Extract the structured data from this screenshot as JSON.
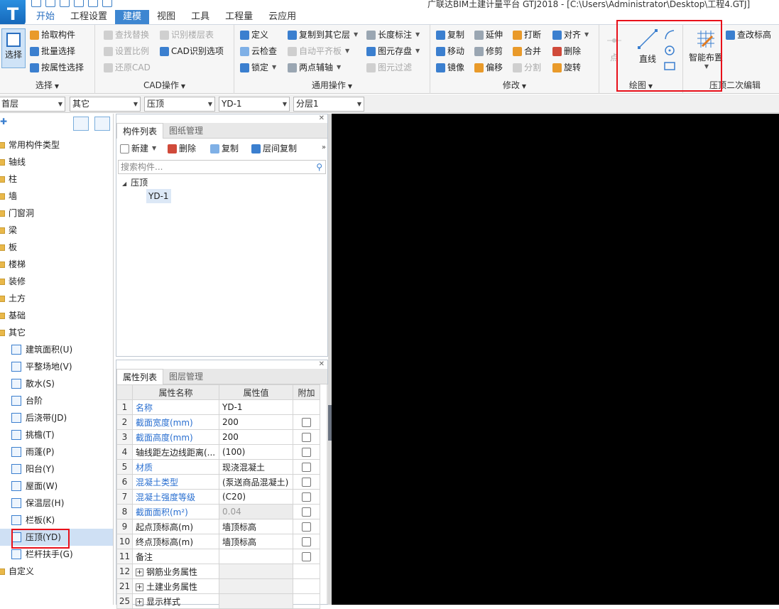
{
  "app": {
    "title": "广联达BIM土建计量平台 GTJ2018 - [C:\\Users\\Administrator\\Desktop\\工程4.GTJ]",
    "logo_letter": "T"
  },
  "menu_tabs": [
    {
      "label": "开始"
    },
    {
      "label": "工程设置"
    },
    {
      "label": "建模"
    },
    {
      "label": "视图"
    },
    {
      "label": "工具"
    },
    {
      "label": "工程量"
    },
    {
      "label": "云应用"
    }
  ],
  "ribbon": {
    "select": {
      "big": "选择",
      "pick": "拾取构件",
      "batch": "批量选择",
      "byprop": "按属性选择",
      "label": "选择"
    },
    "cad": {
      "find_replace": "查找替换",
      "identify_floor": "识别楼层表",
      "set_scale": "设置比例",
      "cad_options": "CAD识别选项",
      "restore_cad": "还原CAD",
      "label": "CAD操作"
    },
    "common": {
      "define": "定义",
      "copy_to_floor": "复制到其它层",
      "length_mark": "长度标注",
      "cloud_check": "云检查",
      "auto_flat": "自动平齐板",
      "save_element": "图元存盘",
      "lock": "锁定",
      "two_point_aux": "两点辅轴",
      "element_filter": "图元过滤",
      "label": "通用操作"
    },
    "modify": {
      "copy": "复制",
      "extend": "延伸",
      "break": "打断",
      "align": "对齐",
      "move": "移动",
      "trim": "修剪",
      "merge": "合并",
      "delete": "删除",
      "mirror": "镜像",
      "offset": "偏移",
      "split": "分割",
      "rotate": "旋转",
      "label": "修改"
    },
    "draw": {
      "point": "点",
      "line": "直线",
      "label": "绘图"
    },
    "secondary": {
      "smart_layout": "智能布置",
      "check_elevation": "查改标高",
      "label": "压顶二次编辑"
    }
  },
  "dropdowns": [
    "首层",
    "其它",
    "压顶",
    "YD-1",
    "分层1"
  ],
  "nav_tree": [
    {
      "label": "常用构件类型",
      "kind": "folder"
    },
    {
      "label": "轴线",
      "kind": "folder"
    },
    {
      "label": "柱",
      "kind": "folder"
    },
    {
      "label": "墙",
      "kind": "folder"
    },
    {
      "label": "门窗洞",
      "kind": "folder"
    },
    {
      "label": "梁",
      "kind": "folder"
    },
    {
      "label": "板",
      "kind": "folder"
    },
    {
      "label": "楼梯",
      "kind": "folder"
    },
    {
      "label": "装修",
      "kind": "folder"
    },
    {
      "label": "土方",
      "kind": "folder"
    },
    {
      "label": "基础",
      "kind": "folder"
    },
    {
      "label": "其它",
      "kind": "folder"
    },
    {
      "label": "建筑面积(U)",
      "kind": "leaf"
    },
    {
      "label": "平整场地(V)",
      "kind": "leaf"
    },
    {
      "label": "散水(S)",
      "kind": "leaf"
    },
    {
      "label": "台阶",
      "kind": "leaf"
    },
    {
      "label": "后浇带(JD)",
      "kind": "leaf"
    },
    {
      "label": "挑檐(T)",
      "kind": "leaf"
    },
    {
      "label": "雨蓬(P)",
      "kind": "leaf"
    },
    {
      "label": "阳台(Y)",
      "kind": "leaf"
    },
    {
      "label": "屋面(W)",
      "kind": "leaf"
    },
    {
      "label": "保温层(H)",
      "kind": "leaf"
    },
    {
      "label": "栏板(K)",
      "kind": "leaf"
    },
    {
      "label": "压顶(YD)",
      "kind": "leaf",
      "selected": true
    },
    {
      "label": "栏杆扶手(G)",
      "kind": "leaf"
    },
    {
      "label": "自定义",
      "kind": "folder"
    }
  ],
  "component_panel": {
    "tab_active": "构件列表",
    "tab_other": "图纸管理",
    "new": "新建",
    "delete": "删除",
    "copy": "复制",
    "floor_copy": "层间复制",
    "search_placeholder": "搜索构件...",
    "tree_root": "压顶",
    "tree_child": "YD-1"
  },
  "property_panel": {
    "tab_active": "属性列表",
    "tab_other": "图层管理",
    "headers": {
      "name": "属性名称",
      "value": "属性值",
      "extra": "附加"
    },
    "rows": [
      {
        "num": "1",
        "name": "名称",
        "value": "YD-1",
        "blue": true,
        "check": false
      },
      {
        "num": "2",
        "name": "截面宽度(mm)",
        "value": "200",
        "blue": true,
        "check": true
      },
      {
        "num": "3",
        "name": "截面高度(mm)",
        "value": "200",
        "blue": true,
        "check": true
      },
      {
        "num": "4",
        "name": "轴线距左边线距离(...",
        "value": "(100)",
        "blue": false,
        "check": true
      },
      {
        "num": "5",
        "name": "材质",
        "value": "现浇混凝土",
        "blue": true,
        "check": true
      },
      {
        "num": "6",
        "name": "混凝土类型",
        "value": "(泵送商品混凝土)",
        "blue": true,
        "check": true
      },
      {
        "num": "7",
        "name": "混凝土强度等级",
        "value": "(C20)",
        "blue": true,
        "check": true
      },
      {
        "num": "8",
        "name": "截面面积(m²)",
        "value": "0.04",
        "blue": true,
        "grey": true,
        "check": true
      },
      {
        "num": "9",
        "name": "起点顶标高(m)",
        "value": "墙顶标高",
        "blue": false,
        "check": true
      },
      {
        "num": "10",
        "name": "终点顶标高(m)",
        "value": "墙顶标高",
        "blue": false,
        "check": true
      },
      {
        "num": "11",
        "name": "备注",
        "value": "",
        "blue": false,
        "check": true
      }
    ],
    "groups": [
      {
        "num": "12",
        "name": "钢筋业务属性"
      },
      {
        "num": "21",
        "name": "土建业务属性"
      },
      {
        "num": "25",
        "name": "显示样式"
      }
    ]
  },
  "colors": {
    "accent": "#3d86d1",
    "highlight_box": "#e8101a",
    "canvas": "#000000"
  }
}
